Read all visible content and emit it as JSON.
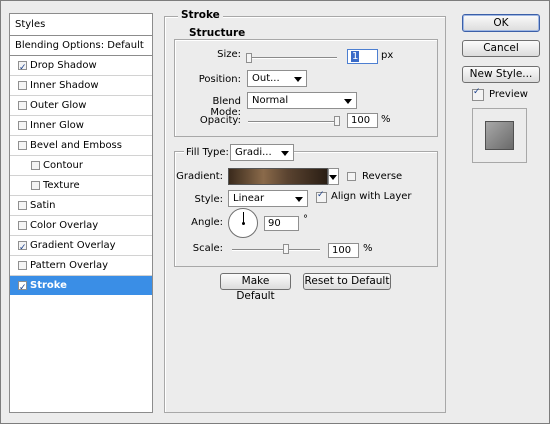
{
  "styles_list": {
    "header": "Styles",
    "blending_options": "Blending Options: Default",
    "items": [
      {
        "label": "Drop Shadow",
        "checked": true,
        "sub": false,
        "selected": false
      },
      {
        "label": "Inner Shadow",
        "checked": false,
        "sub": false,
        "selected": false
      },
      {
        "label": "Outer Glow",
        "checked": false,
        "sub": false,
        "selected": false
      },
      {
        "label": "Inner Glow",
        "checked": false,
        "sub": false,
        "selected": false
      },
      {
        "label": "Bevel and Emboss",
        "checked": false,
        "sub": false,
        "selected": false
      },
      {
        "label": "Contour",
        "checked": false,
        "sub": true,
        "selected": false
      },
      {
        "label": "Texture",
        "checked": false,
        "sub": true,
        "selected": false
      },
      {
        "label": "Satin",
        "checked": false,
        "sub": false,
        "selected": false
      },
      {
        "label": "Color Overlay",
        "checked": false,
        "sub": false,
        "selected": false
      },
      {
        "label": "Gradient Overlay",
        "checked": true,
        "sub": false,
        "selected": false
      },
      {
        "label": "Pattern Overlay",
        "checked": false,
        "sub": false,
        "selected": false
      },
      {
        "label": "Stroke",
        "checked": true,
        "sub": false,
        "selected": true
      }
    ]
  },
  "stroke": {
    "title": "Stroke",
    "structure": {
      "title": "Structure",
      "size_label": "Size:",
      "size_value": "1",
      "size_unit": "px",
      "position_label": "Position:",
      "position_value": "Out...",
      "blend_mode_label": "Blend Mode:",
      "blend_mode_value": "Normal",
      "opacity_label": "Opacity:",
      "opacity_value": "100",
      "opacity_unit": "%"
    },
    "fill": {
      "fill_type_label": "Fill Type:",
      "fill_type_value": "Gradi...",
      "gradient_label": "Gradient:",
      "reverse_label": "Reverse",
      "reverse_checked": false,
      "style_label": "Style:",
      "style_value": "Linear",
      "align_label": "Align with Layer",
      "align_checked": true,
      "angle_label": "Angle:",
      "angle_value": "90",
      "angle_unit": "°",
      "scale_label": "Scale:",
      "scale_value": "100",
      "scale_unit": "%"
    },
    "make_default": "Make Default",
    "reset_default": "Reset to Default"
  },
  "buttons": {
    "ok": "OK",
    "cancel": "Cancel",
    "new_style": "New Style...",
    "preview_label": "Preview",
    "preview_checked": true
  },
  "colors": {
    "selection": "#3a8ee6",
    "background": "#ececec"
  }
}
